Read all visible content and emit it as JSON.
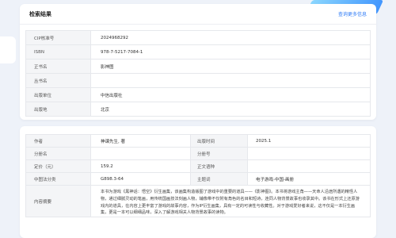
{
  "section1": {
    "title": "检索结果",
    "link": "查询更多信息",
    "rows": [
      {
        "label": "CIP核准号",
        "value": "2024968292"
      },
      {
        "label": "ISBN",
        "value": "978-7-5217-7084-1"
      },
      {
        "label": "正书名",
        "value": "影神图"
      },
      {
        "label": "丛书名",
        "value": ""
      },
      {
        "label": "出版单位",
        "value": "中信出版社"
      },
      {
        "label": "出版地",
        "value": "北京"
      }
    ]
  },
  "section2": {
    "author_label": "作者",
    "author_value": "神课先生, 著",
    "pubtime_label": "出版时间",
    "pubtime_value": "2025.1",
    "part_label": "分册名",
    "part_value": "",
    "partno_label": "分册号",
    "partno_value": "",
    "price_label": "定价（元）",
    "price_value": "159.2",
    "source_label": "正文语种",
    "source_value": "",
    "clc_label": "中图法分类",
    "clc_value": "G898.3-64",
    "subject_label": "主题词",
    "subject_value": "电子游戏-中国-画册",
    "abstract_label": "内容摘要",
    "abstract_value": "本书为游戏《黑神话：悟空》衍生画集，该画集构造版图了游戏中的重要的道具——《影神图》。本书将游戏主角——天命人沿途所遇的精怪人物，通过细腻灵动的笔画，用传统国画技法刻画人物，辅像带不仅附有角色的名目和短诗，连同人物背景故事也收录其中。该书在形式上还原游戏内的道具，在内容上更丰富了游戏的故事内容，作为IP衍生画集，具有一定的可读性与收藏性。对于游戏爱好者来说，这不仅是一本衍生画集，更是一本可以细细品味，深入了解游戏相关人物背景故事的读物。"
  }
}
